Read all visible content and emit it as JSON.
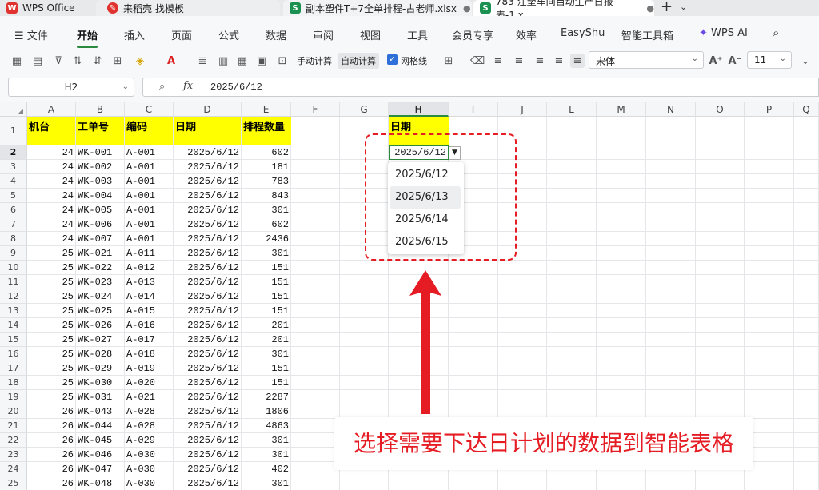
{
  "tabs": [
    {
      "label": "WPS Office",
      "icon": "wps-logo-icon"
    },
    {
      "label": "来稻壳 找模板",
      "icon": "docer-icon"
    },
    {
      "label": "副本塑件T+7全单排程-古老师.xlsx",
      "icon": "sheet-icon"
    },
    {
      "label": "783 注塑车间自动生产日报表-1.x",
      "icon": "sheet-icon"
    }
  ],
  "menu": {
    "file": "文件",
    "items": [
      "开始",
      "插入",
      "页面",
      "公式",
      "数据",
      "审阅",
      "视图",
      "工具",
      "会员专享",
      "效率",
      "EasyShu",
      "智能工具箱",
      "WPS AI"
    ]
  },
  "toolbar": {
    "manual_calc": "手动计算",
    "auto_calc": "自动计算",
    "gridlines": "网格线",
    "font": "宋体",
    "font_size": "11"
  },
  "formula": {
    "cell_ref": "H2",
    "fx": "fx",
    "value": "2025/6/12"
  },
  "columns": [
    "A",
    "B",
    "C",
    "D",
    "E",
    "F",
    "G",
    "H",
    "I",
    "J",
    "L",
    "M",
    "N",
    "O",
    "P",
    "Q"
  ],
  "row_numbers": [
    "1",
    "2",
    "3",
    "4",
    "5",
    "6",
    "7",
    "8",
    "9",
    "10",
    "11",
    "12",
    "13",
    "14",
    "15",
    "16",
    "17",
    "18",
    "19",
    "20",
    "21",
    "22",
    "23",
    "24",
    "25"
  ],
  "headers": {
    "a": "机台",
    "b": "工单号",
    "c": "编码",
    "d": "日期",
    "e": "排程数量",
    "h": "日期"
  },
  "rows": [
    {
      "a": "24",
      "b": "WK-001",
      "c": "A-001",
      "d": "2025/6/12",
      "e": "602"
    },
    {
      "a": "24",
      "b": "WK-002",
      "c": "A-001",
      "d": "2025/6/12",
      "e": "181"
    },
    {
      "a": "24",
      "b": "WK-003",
      "c": "A-001",
      "d": "2025/6/12",
      "e": "783"
    },
    {
      "a": "24",
      "b": "WK-004",
      "c": "A-001",
      "d": "2025/6/12",
      "e": "843"
    },
    {
      "a": "24",
      "b": "WK-005",
      "c": "A-001",
      "d": "2025/6/12",
      "e": "301"
    },
    {
      "a": "24",
      "b": "WK-006",
      "c": "A-001",
      "d": "2025/6/12",
      "e": "602"
    },
    {
      "a": "24",
      "b": "WK-007",
      "c": "A-001",
      "d": "2025/6/12",
      "e": "2436"
    },
    {
      "a": "25",
      "b": "WK-021",
      "c": "A-011",
      "d": "2025/6/12",
      "e": "301"
    },
    {
      "a": "25",
      "b": "WK-022",
      "c": "A-012",
      "d": "2025/6/12",
      "e": "151"
    },
    {
      "a": "25",
      "b": "WK-023",
      "c": "A-013",
      "d": "2025/6/12",
      "e": "151"
    },
    {
      "a": "25",
      "b": "WK-024",
      "c": "A-014",
      "d": "2025/6/12",
      "e": "151"
    },
    {
      "a": "25",
      "b": "WK-025",
      "c": "A-015",
      "d": "2025/6/12",
      "e": "151"
    },
    {
      "a": "25",
      "b": "WK-026",
      "c": "A-016",
      "d": "2025/6/12",
      "e": "201"
    },
    {
      "a": "25",
      "b": "WK-027",
      "c": "A-017",
      "d": "2025/6/12",
      "e": "201"
    },
    {
      "a": "25",
      "b": "WK-028",
      "c": "A-018",
      "d": "2025/6/12",
      "e": "301"
    },
    {
      "a": "25",
      "b": "WK-029",
      "c": "A-019",
      "d": "2025/6/12",
      "e": "151"
    },
    {
      "a": "25",
      "b": "WK-030",
      "c": "A-020",
      "d": "2025/6/12",
      "e": "151"
    },
    {
      "a": "25",
      "b": "WK-031",
      "c": "A-021",
      "d": "2025/6/12",
      "e": "2287"
    },
    {
      "a": "26",
      "b": "WK-043",
      "c": "A-028",
      "d": "2025/6/12",
      "e": "1806"
    },
    {
      "a": "26",
      "b": "WK-044",
      "c": "A-028",
      "d": "2025/6/12",
      "e": "4863"
    },
    {
      "a": "26",
      "b": "WK-045",
      "c": "A-029",
      "d": "2025/6/12",
      "e": "301"
    },
    {
      "a": "26",
      "b": "WK-046",
      "c": "A-030",
      "d": "2025/6/12",
      "e": "301"
    },
    {
      "a": "26",
      "b": "WK-047",
      "c": "A-030",
      "d": "2025/6/12",
      "e": "402"
    },
    {
      "a": "26",
      "b": "WK-048",
      "c": "A-030",
      "d": "2025/6/12",
      "e": "301"
    }
  ],
  "h2_value": "2025/6/12",
  "dropdown_options": [
    "2025/6/12",
    "2025/6/13",
    "2025/6/14",
    "2025/6/15"
  ],
  "caption": "选择需要下达日计划的数据到智能表格",
  "colors": {
    "header_fill": "#ffff00",
    "accent_green": "#2b8a3e",
    "annotation_red": "#e51c23"
  }
}
